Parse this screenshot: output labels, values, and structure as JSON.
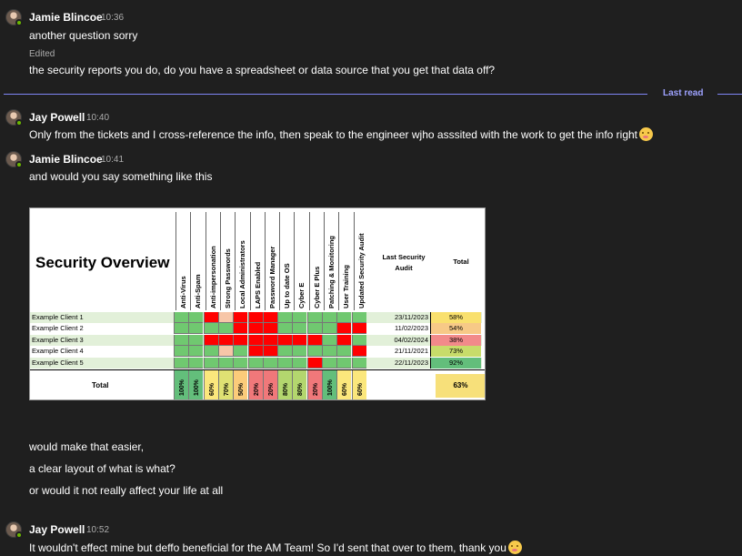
{
  "messages": [
    {
      "author": "Jamie Blincoe",
      "time": "10:36",
      "lines": [
        "another question sorry"
      ],
      "edited_label": "Edited",
      "lines_after_edit": [
        "the security reports you do, do you have a spreadsheet or data source that you get that data off?"
      ]
    },
    {
      "author": "Jay Powell",
      "time": "10:40",
      "lines": [
        "Only from the tickets and I cross-reference the info, then speak to the engineer wjho asssited with the work to get the info right"
      ]
    },
    {
      "author": "Jamie Blincoe",
      "time": "10:41",
      "lines": [
        "and would you say something like this"
      ],
      "lines_after_image": [
        "would make that easier,",
        "a clear layout of what is what?",
        "or would it not really affect your life at all"
      ]
    },
    {
      "author": "Jay Powell",
      "time": "10:52",
      "lines": [
        "It wouldn't effect mine but deffo beneficial for the AM Team! So I'd sent that over to them, thank you"
      ]
    }
  ],
  "last_read_label": "Last read",
  "colors": {
    "background": "#1f1f1f",
    "accent": "#7f85f5",
    "presence": "#6bb700",
    "green": "#70c870",
    "red": "#ff0000",
    "peach": "#f7c6a8"
  },
  "sheet": {
    "title": "Security Overview",
    "columns": [
      "Anti-Virus",
      "Anti-Spam",
      "Anti-impersonation",
      "Strong Passwords",
      "Local Administrators",
      "LAPS Enabled",
      "Password Manager",
      "Up to date OS",
      "Cyber E",
      "Cyber E Plus",
      "Patching & Monitoring",
      "User Training",
      "Updated Security Audit"
    ],
    "audit_header": "Last Security Audit",
    "total_header": "Total",
    "rows": [
      {
        "name": "Example Client 1",
        "cells": [
          "g",
          "g",
          "r",
          "p",
          "r",
          "r",
          "r",
          "g",
          "g",
          "g",
          "g",
          "g",
          "g"
        ],
        "date": "23/11/2023",
        "total": "58%"
      },
      {
        "name": "Example Client 2",
        "cells": [
          "g",
          "g",
          "g",
          "g",
          "r",
          "r",
          "r",
          "g",
          "g",
          "g",
          "g",
          "r",
          "r"
        ],
        "date": "11/02/2023",
        "total": "54%"
      },
      {
        "name": "Example Client 3",
        "cells": [
          "g",
          "g",
          "r",
          "r",
          "r",
          "r",
          "r",
          "r",
          "r",
          "r",
          "g",
          "r",
          "g"
        ],
        "date": "04/02/2024",
        "total": "38%"
      },
      {
        "name": "Example Client 4",
        "cells": [
          "g",
          "g",
          "g",
          "p",
          "g",
          "r",
          "r",
          "g",
          "g",
          "g",
          "g",
          "g",
          "r"
        ],
        "date": "21/11/2021",
        "total": "73%"
      },
      {
        "name": "Example Client 5",
        "cells": [
          "g",
          "g",
          "g",
          "g",
          "g",
          "g",
          "g",
          "g",
          "g",
          "r",
          "g",
          "g",
          "g"
        ],
        "date": "22/11/2023",
        "total": "92%"
      }
    ],
    "total_label": "Total",
    "column_totals": [
      "100%",
      "100%",
      "60%",
      "70%",
      "50%",
      "20%",
      "20%",
      "80%",
      "80%",
      "20%",
      "100%",
      "60%",
      "60%"
    ],
    "overall_total": "63%"
  }
}
